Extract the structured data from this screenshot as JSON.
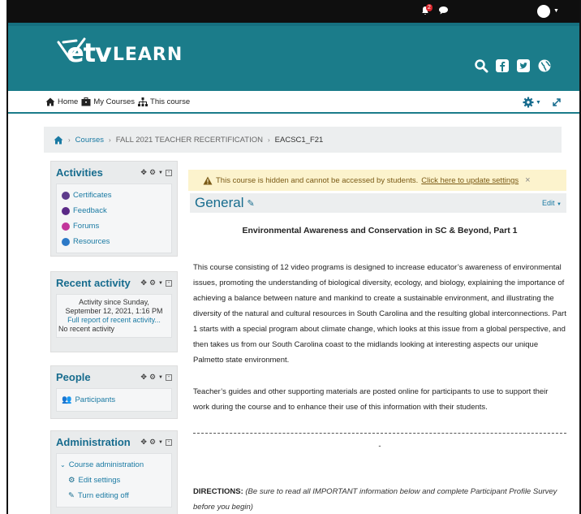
{
  "header": {
    "notification_count": "2",
    "logo_text_etv": "etv",
    "logo_text_learn": "LEARN"
  },
  "nav": {
    "items": [
      "Home",
      "My Courses",
      "This course"
    ]
  },
  "breadcrumb": {
    "items": [
      "Courses",
      "FALL 2021 TEACHER RECERTIFICATION",
      "EACSC1_F21"
    ]
  },
  "blocks": {
    "activities": {
      "title": "Activities",
      "items": [
        {
          "label": "Certificates",
          "color": "#5d3b8b"
        },
        {
          "label": "Feedback",
          "color": "#5b2a87"
        },
        {
          "label": "Forums",
          "color": "#c2369b"
        },
        {
          "label": "Resources",
          "color": "#2c79c7"
        }
      ]
    },
    "recent": {
      "title": "Recent activity",
      "line1": "Activity since Sunday,",
      "line2": "September 12, 2021, 1:16 PM",
      "link": "Full report of recent activity...",
      "none": "No recent activity"
    },
    "people": {
      "title": "People",
      "participants": "Participants"
    },
    "admin": {
      "title": "Administration",
      "course_admin": "Course administration",
      "edit_settings": "Edit settings",
      "turn_editing_off": "Turn editing off"
    }
  },
  "alert": {
    "text": "This course is hidden and cannot be accessed by students.",
    "link": "Click here to update settings",
    "close": "×"
  },
  "section": {
    "title": "General",
    "edit": "Edit"
  },
  "content": {
    "heading": "Environmental Awareness and Conservation in SC & Beyond, Part 1",
    "paragraph1": "This course consisting of 12 video programs is designed to increase educator’s awareness of environmental issues, promoting the understanding of biological diversity, ecology, and biology, explaining the importance of achieving a balance between nature and mankind to create a sustainable environment, and illustrating the diversity of the natural and cultural resources in South Carolina and the resulting global interconnections. Part 1 starts with a special program about climate change, which looks at this issue from a global perspective, and then takes us from our South Carolina coast to the midlands looking at interesting aspects our unique Palmetto state environment.",
    "paragraph2": "Teacher’s guides and other supporting materials are posted online for participants to use to support their work during the course and to enhance their use of this information with their students.",
    "dash": "-",
    "directions_label": "DIRECTIONS:",
    "directions_text": "(Be sure to read all IMPORTANT information below  and complete Participant Profile Survey before you begin)"
  }
}
